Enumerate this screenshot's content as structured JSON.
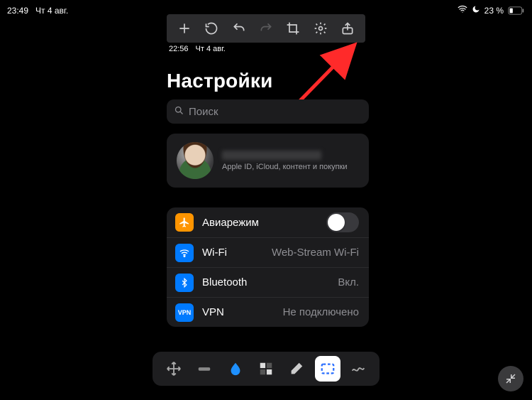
{
  "outer_status": {
    "time": "23:49",
    "date": "Чт 4 авг.",
    "wifi": true,
    "dnd": true,
    "battery_percent": "23 %"
  },
  "top_toolbar": {
    "add": "add",
    "rotate": "rotate",
    "undo": "undo",
    "redo": "redo",
    "crop": "crop",
    "settings": "settings",
    "share": "share"
  },
  "inner_status": {
    "time": "22:56",
    "date": "Чт 4 авг."
  },
  "settings": {
    "title": "Настройки",
    "search_placeholder": "Поиск",
    "profile_sub": "Apple ID, iCloud, контент и покупки",
    "rows": {
      "airplane": {
        "label": "Авиарежим",
        "toggle": false
      },
      "wifi": {
        "label": "Wi-Fi",
        "value": "Web-Stream Wi-Fi"
      },
      "bluetooth": {
        "label": "Bluetooth",
        "value": "Вкл."
      },
      "vpn": {
        "label": "VPN",
        "value": "Не подключено",
        "badge": "VPN"
      }
    }
  },
  "dock": {
    "move": "move",
    "line": "line",
    "drop": "drop",
    "mosaic": "mosaic",
    "eraser": "eraser",
    "marquee": "marquee",
    "scribble": "scribble",
    "active": "marquee"
  },
  "colors": {
    "arrow": "#ff2a2a",
    "marquee": "#2b6fff"
  }
}
